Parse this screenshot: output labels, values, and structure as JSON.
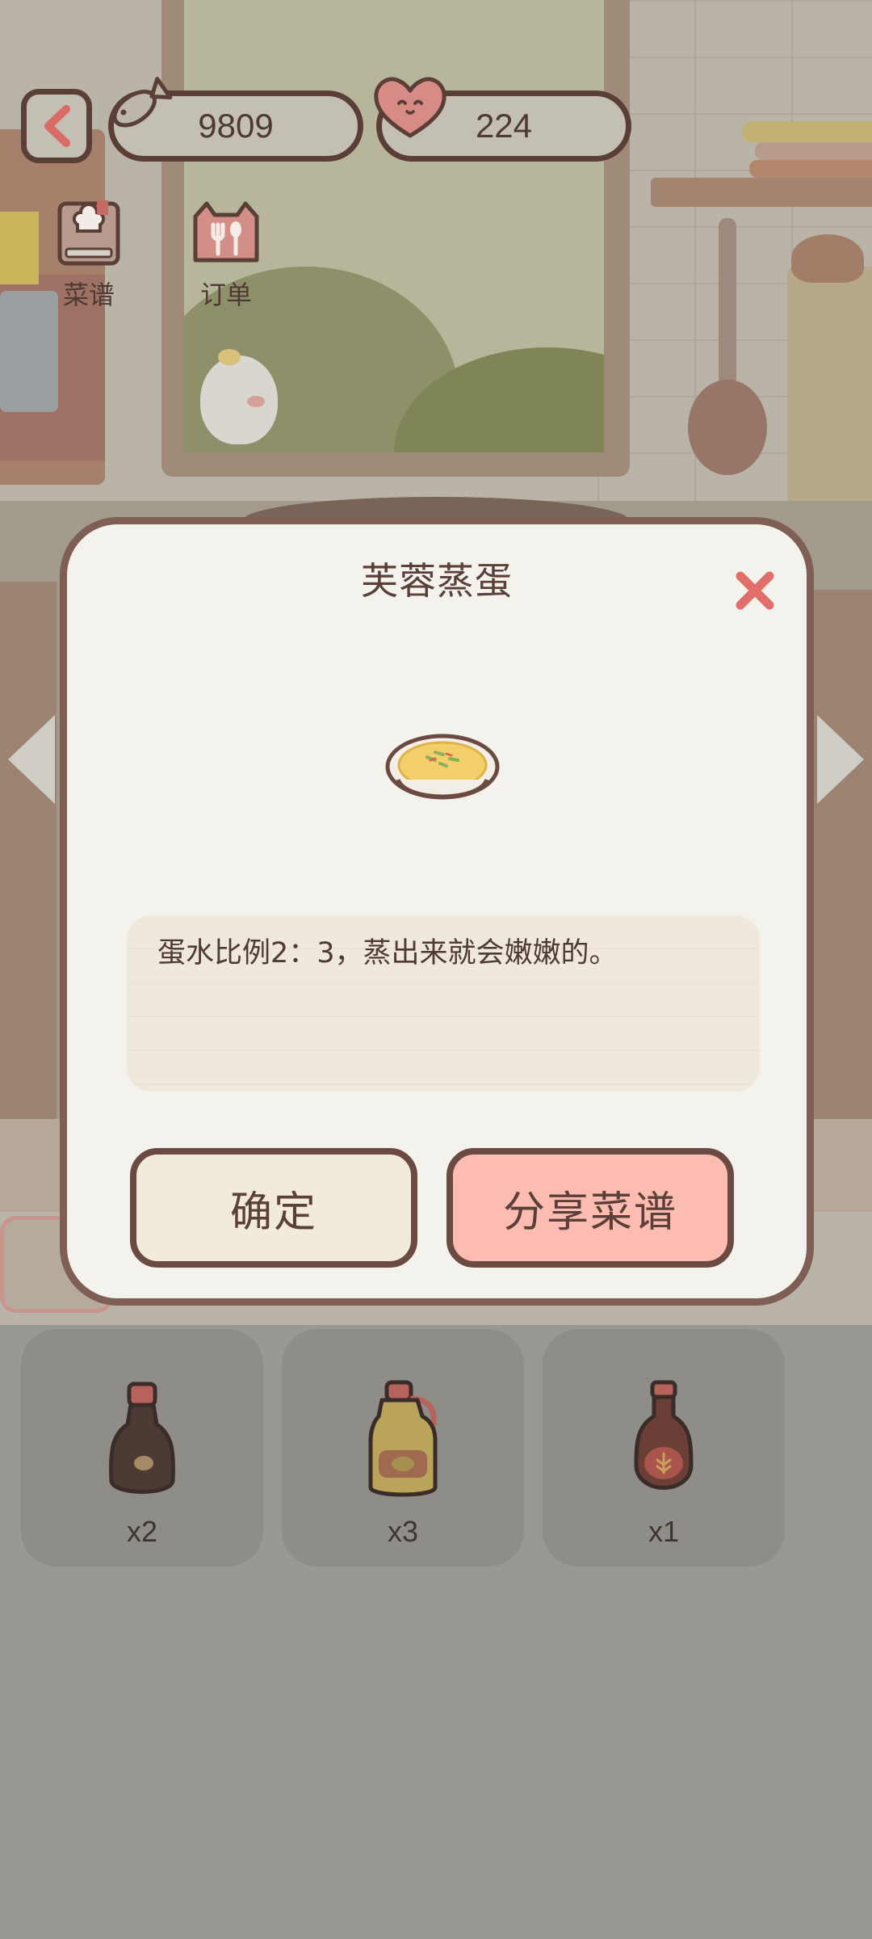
{
  "hud": {
    "fish_coins": "9809",
    "hearts": "224",
    "shortcuts": [
      {
        "label": "菜谱",
        "icon": "recipe-book-icon"
      },
      {
        "label": "订单",
        "icon": "cat-fork-spoon-icon"
      }
    ]
  },
  "modal": {
    "title": "芙蓉蒸蛋",
    "dish_icon": "steamed-egg-bowl-icon",
    "description": "蛋水比例2：3，蒸出来就会嫩嫩的。",
    "confirm_label": "确定",
    "share_label": "分享菜谱"
  },
  "inventory": [
    {
      "icon": "soy-sauce-bottle-icon",
      "count": "x2"
    },
    {
      "icon": "cooking-oil-jug-icon",
      "count": "x3"
    },
    {
      "icon": "vinegar-bottle-icon",
      "count": "x1"
    }
  ],
  "colors": {
    "modal_border": "#7f5e54",
    "share_button": "#fdbcb1",
    "close_icon": "#e26e69"
  }
}
